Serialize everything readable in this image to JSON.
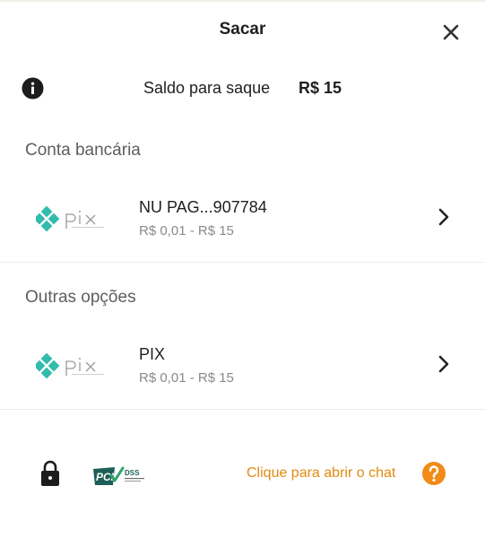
{
  "header": {
    "title": "Sacar",
    "close_icon": "close-icon"
  },
  "balance": {
    "label": "Saldo para saque",
    "value": "R$ 15",
    "icon": "info-icon"
  },
  "sections": [
    {
      "title": "Conta bancária",
      "items": [
        {
          "logo": "pix",
          "name": "NU PAG...907784",
          "range": "R$ 0,01 - R$ 15"
        }
      ]
    },
    {
      "title": "Outras opções",
      "items": [
        {
          "logo": "pix",
          "name": "PIX",
          "range": "R$ 0,01 - R$ 15"
        }
      ]
    }
  ],
  "footer": {
    "lock_icon": "lock-icon",
    "pci_logo_text": "PCI DSS",
    "chat_text": "Clique para abrir o chat",
    "help_icon": "question-icon"
  },
  "colors": {
    "accent": "#e28a10",
    "help": "#f28a17",
    "pix": "#32bcad",
    "text": "#1f1f1f",
    "muted": "#8a8a8a"
  }
}
